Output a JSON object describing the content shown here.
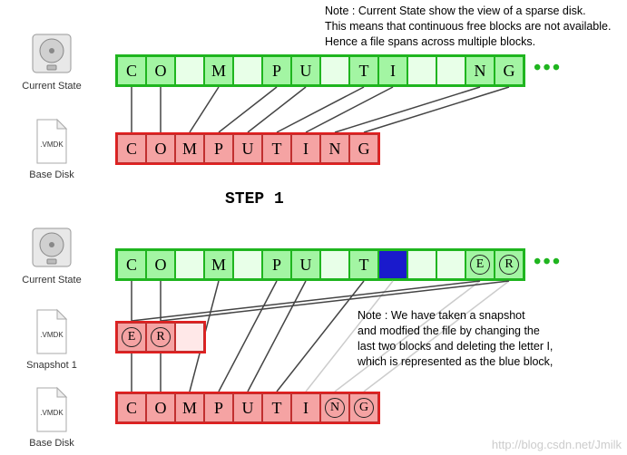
{
  "note_top": {
    "line1": "Note : Current State show the view of a sparse disk.",
    "line2": "This means that continuous free blocks are not available.",
    "line3": "Hence a file spans across multiple blocks."
  },
  "labels": {
    "current_state": "Current State",
    "base_disk": "Base Disk",
    "snapshot_1": "Snapshot 1",
    "vmdk": ".VMDK"
  },
  "step_label": "STEP 1",
  "top": {
    "sparse_letters": [
      "C",
      "O",
      "",
      "M",
      "",
      "P",
      "U",
      "",
      "T",
      "I",
      "",
      "",
      "N",
      "G"
    ],
    "base_letters": [
      "C",
      "O",
      "M",
      "P",
      "U",
      "T",
      "I",
      "N",
      "G"
    ]
  },
  "bottom": {
    "sparse_letters": [
      "C",
      "O",
      "",
      "M",
      "",
      "P",
      "U",
      "",
      "T",
      "BLUE",
      "",
      "",
      "E",
      "R"
    ],
    "snapshot_letters": [
      "E",
      "R",
      ""
    ],
    "base_letters": [
      "C",
      "O",
      "M",
      "P",
      "U",
      "T",
      "I",
      "N",
      "G"
    ],
    "circled_in_sparse": [
      12,
      13
    ],
    "circled_in_snapshot": [
      0,
      1
    ],
    "circled_in_base": [
      7,
      8
    ]
  },
  "note_bottom": {
    "line1": "Note : We have taken a snapshot",
    "line2": "and modfied the file by changing the",
    "line3": "last two blocks and deleting the letter I,",
    "line4": "which is represented as the blue block,"
  },
  "dots": "•••",
  "watermark": "http://blog.csdn.net/Jmilk"
}
